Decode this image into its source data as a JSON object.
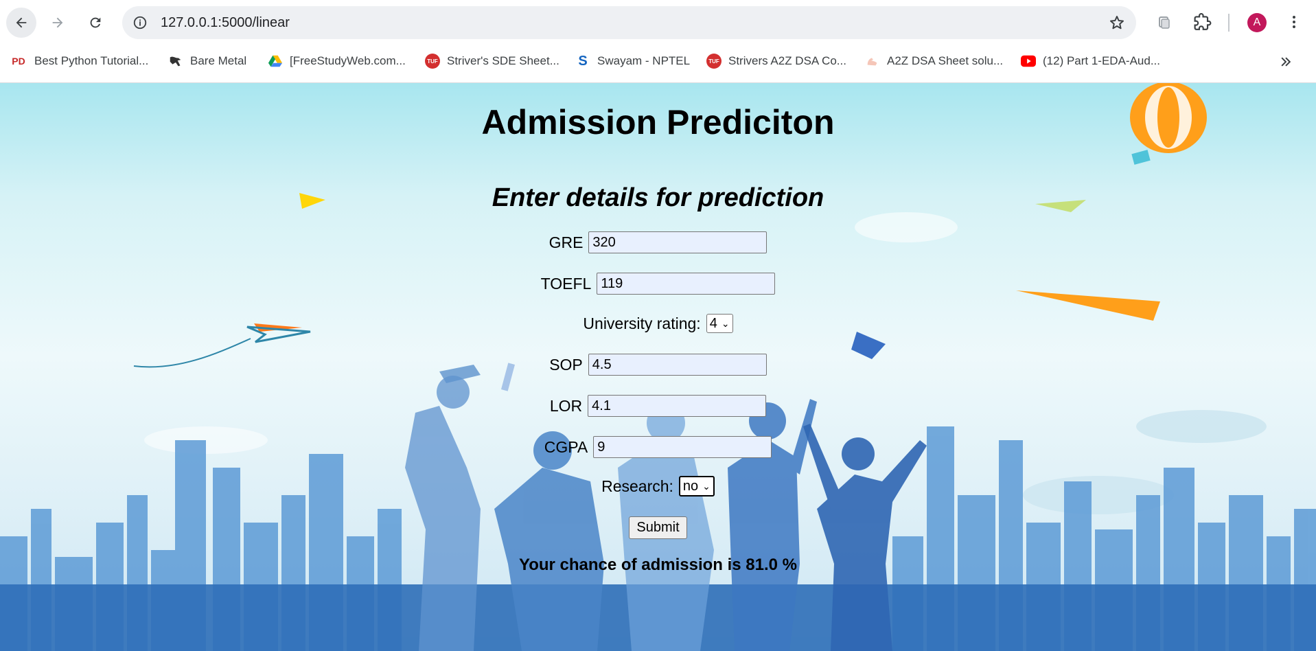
{
  "browser": {
    "url": "127.0.0.1:5000/linear",
    "avatar_letter": "A",
    "bookmarks": [
      {
        "label": "Best Python Tutorial...",
        "icon": "pd-icon"
      },
      {
        "label": "Bare Metal",
        "icon": "dragon-icon"
      },
      {
        "label": "[FreeStudyWeb.com...",
        "icon": "google-drive-icon"
      },
      {
        "label": "Striver's SDE Sheet...",
        "icon": "tuf-icon"
      },
      {
        "label": "Swayam - NPTEL",
        "icon": "swayam-icon"
      },
      {
        "label": "Strivers A2Z DSA Co...",
        "icon": "tuf-icon"
      },
      {
        "label": "A2Z DSA Sheet solu...",
        "icon": "arm-icon"
      },
      {
        "label": "(12) Part 1-EDA-Aud...",
        "icon": "youtube-icon"
      }
    ]
  },
  "page": {
    "title": "Admission Prediciton",
    "subtitle": "Enter details for prediction",
    "form": {
      "gre": {
        "label": "GRE",
        "value": "320"
      },
      "toefl": {
        "label": "TOEFL",
        "value": "119"
      },
      "university_rating": {
        "label": "University rating:",
        "value": "4"
      },
      "sop": {
        "label": "SOP",
        "value": "4.5"
      },
      "lor": {
        "label": "LOR",
        "value": "4.1"
      },
      "cgpa": {
        "label": "CGPA",
        "value": "9"
      },
      "research": {
        "label": "Research:",
        "value": "no"
      },
      "submit_label": "Submit"
    },
    "result": "Your chance of admission is 81.0 %"
  },
  "colors": {
    "avatar": "#c2185b",
    "input_autofill": "#e8f0fe"
  }
}
